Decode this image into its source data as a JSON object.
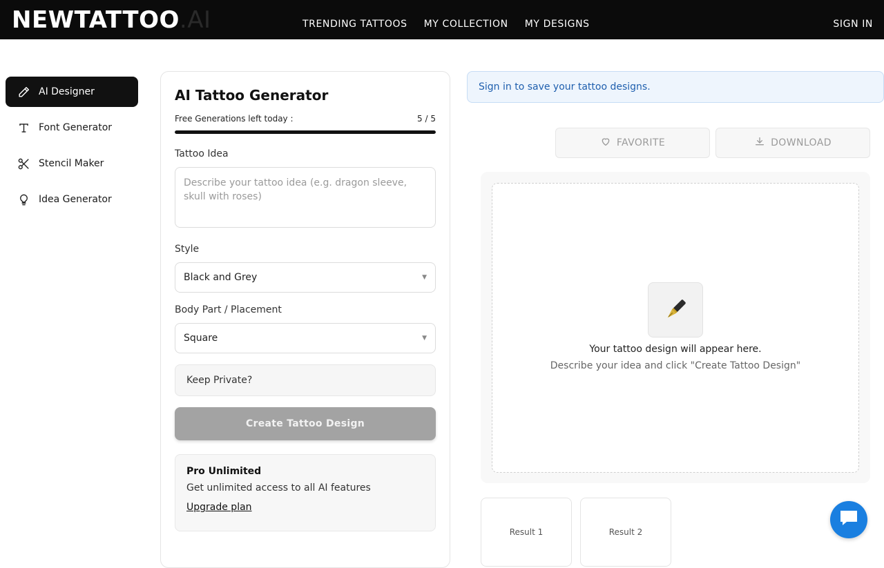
{
  "header": {
    "logo_main": "NEWTATTOO",
    "logo_suffix": ".AI",
    "nav": [
      "TRENDING TATTOOS",
      "MY COLLECTION",
      "MY DESIGNS"
    ],
    "signin": "SIGN IN"
  },
  "sidebar": {
    "items": [
      {
        "label": "AI Designer",
        "icon": "pencil-icon",
        "active": true
      },
      {
        "label": "Font Generator",
        "icon": "text-icon",
        "active": false
      },
      {
        "label": "Stencil Maker",
        "icon": "scissors-icon",
        "active": false
      },
      {
        "label": "Idea Generator",
        "icon": "lightbulb-icon",
        "active": false
      }
    ]
  },
  "form": {
    "title": "AI Tattoo Generator",
    "quota_label": "Free Generations left today :",
    "quota_value": "5 / 5",
    "quota_fraction": 1.0,
    "idea_label": "Tattoo Idea",
    "idea_placeholder": "Describe your tattoo idea (e.g. dragon sleeve, skull with roses)",
    "style_label": "Style",
    "style_value": "Black and Grey",
    "placement_label": "Body Part / Placement",
    "placement_value": "Square",
    "private_label": "Keep Private?",
    "create_button": "Create Tattoo Design",
    "pro_title": "Pro Unlimited",
    "pro_desc": "Get unlimited access to all AI features",
    "pro_link": "Upgrade plan"
  },
  "preview": {
    "banner": "Sign in to save your tattoo designs.",
    "favorite": "FAVORITE",
    "download": "DOWNLOAD",
    "empty_title": "Your tattoo design will appear here.",
    "empty_sub": "Describe your idea and click \"Create Tattoo Design\"",
    "results": [
      "Result 1",
      "Result 2"
    ]
  },
  "colors": {
    "header_bg": "#0b0b0b",
    "accent": "#111111",
    "banner_text": "#1f5fae",
    "chat_button": "#1a7fe0"
  }
}
